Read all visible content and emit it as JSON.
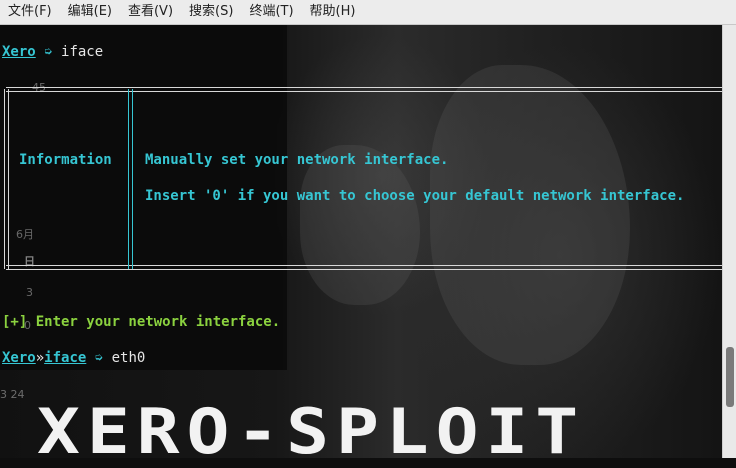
{
  "menu": [
    "文件(F)",
    "编辑(E)",
    "查看(V)",
    "搜索(S)",
    "终端(T)",
    "帮助(H)"
  ],
  "prompt1": {
    "host": "Xero",
    "arrow": " ➭ ",
    "cmd": "iface"
  },
  "info": {
    "label": "Information",
    "line1": "Manually set your network interface.",
    "line2": "Insert '0' if you want to choose your default network interface."
  },
  "enter_prompt": "[+] Enter your network interface.",
  "prompt2": {
    "host": "Xero",
    "sep": "»",
    "module": "iface",
    "arrow": " ➭ ",
    "input": "eth0"
  },
  "banner": "XERO-SPLOIT",
  "ghost": {
    "a": "45",
    "b": "6月",
    "c": "日",
    "d": "3",
    "e": "0",
    "f": "3  24"
  },
  "scroll": {
    "position": 0.78
  }
}
